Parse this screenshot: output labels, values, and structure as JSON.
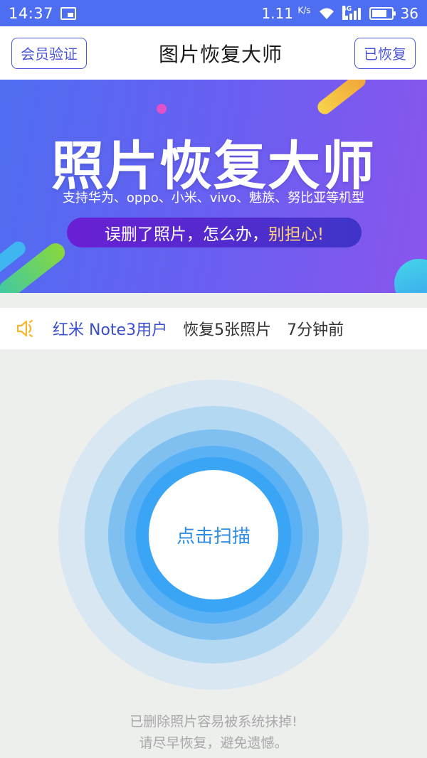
{
  "status_bar": {
    "time": "14:37",
    "speed_value": "1.11",
    "speed_unit": "K/s",
    "network": "4G",
    "battery": "36"
  },
  "header": {
    "left_button": "会员验证",
    "title": "图片恢复大师",
    "right_button": "已恢复"
  },
  "banner": {
    "title": "照片恢复大师",
    "subtitle": "支持华为、oppo、小米、vivo、魅族、努比亚等机型",
    "pill_text": "误删了照片，怎么办，",
    "pill_highlight": "别担心!"
  },
  "notice": {
    "icon": "speaker-icon",
    "user": "红米 Note3用户",
    "action": "恢复5张照片",
    "time": "7分钟前"
  },
  "scan": {
    "button_label": "点击扫描"
  },
  "footer": {
    "line1": "已删除照片容易被系统抹掉!",
    "line2": "请尽早恢复，避免遗憾。"
  },
  "colors": {
    "status_bar": "#4d6ef0",
    "accent": "#4a56d4",
    "scan_blue": "#3aa4f5",
    "highlight": "#ffd27a"
  }
}
